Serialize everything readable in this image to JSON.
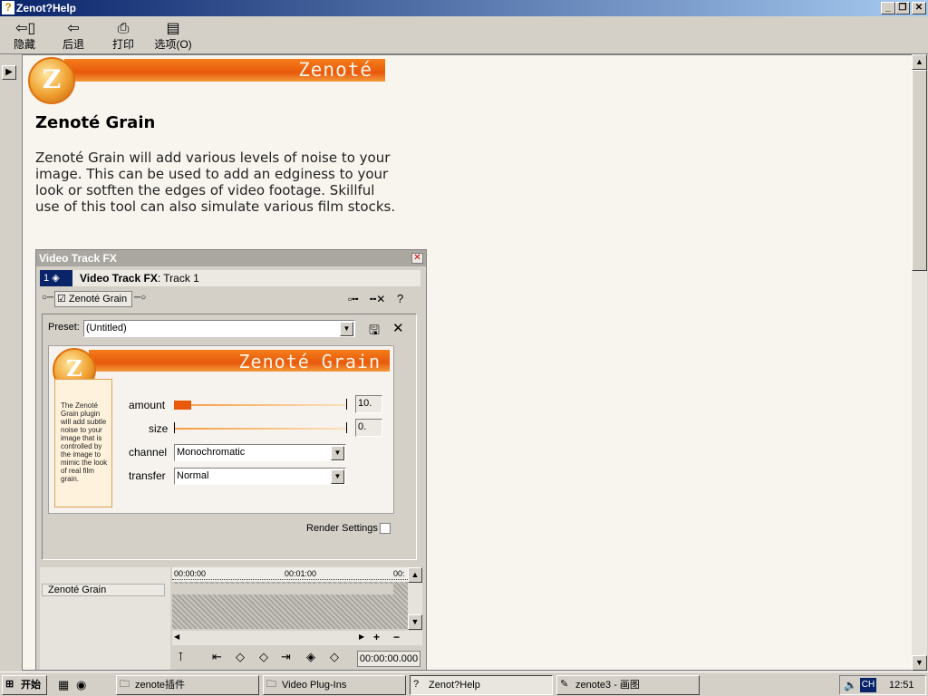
{
  "window": {
    "title": "Zenot?Help",
    "controls": {
      "minimize": "_",
      "restore": "❐",
      "close": "✕"
    }
  },
  "toolbar": {
    "hide": "隐藏",
    "back": "后退",
    "print": "打印",
    "options": "选项(O)"
  },
  "page": {
    "banner_brand": "Zenoté",
    "logo_letter": "Z",
    "title": "Zenoté Grain",
    "intro": "Zenoté Grain will add various levels of noise to your image. This can be used to add an edginess to your look or sotften the edges of video footage. Skillful use of this tool can also simulate various film stocks."
  },
  "dialog": {
    "title": "Video Track FX",
    "track_number": "1",
    "heading_bold": "Video Track FX",
    "heading_rest": ": Track 1",
    "plugin_chain_item": "Zenoté Grain",
    "preset_label": "Preset:",
    "preset_value": "(Untitled)",
    "plugin": {
      "banner_title": "Zenoté Grain",
      "logo_letter": "Z",
      "description": "The Zenoté Grain plugin will add subtle noise to your image that is controlled by the image to mimic the look of real film grain.",
      "amount_label": "amount",
      "amount_value": "10.",
      "amount_level": 0.1,
      "size_label": "size",
      "size_value": "0.",
      "size_level": 0,
      "channel_label": "channel",
      "channel_value": "Monochromatic",
      "transfer_label": "transfer",
      "transfer_value": "Normal"
    },
    "render_settings_label": "Render Settings",
    "timeline": {
      "track_name": "Zenoté Grain",
      "ruler_start": "00:00:00",
      "ruler_mid": "00:01:00",
      "ruler_end": "00:",
      "timecode": "00:00:00.000"
    }
  },
  "taskbar": {
    "start_label": "开始",
    "tasks": [
      {
        "label": "zenote插件"
      },
      {
        "label": "Video Plug-Ins"
      },
      {
        "label": "Zenot?Help"
      },
      {
        "label": "zenote3 - 画图"
      }
    ],
    "lang": "CH",
    "clock": "12:51"
  },
  "colors": {
    "banner_orange": "#e8590c",
    "titlebar_blue": "#0a246a",
    "page_bg": "#f8f5ee"
  }
}
